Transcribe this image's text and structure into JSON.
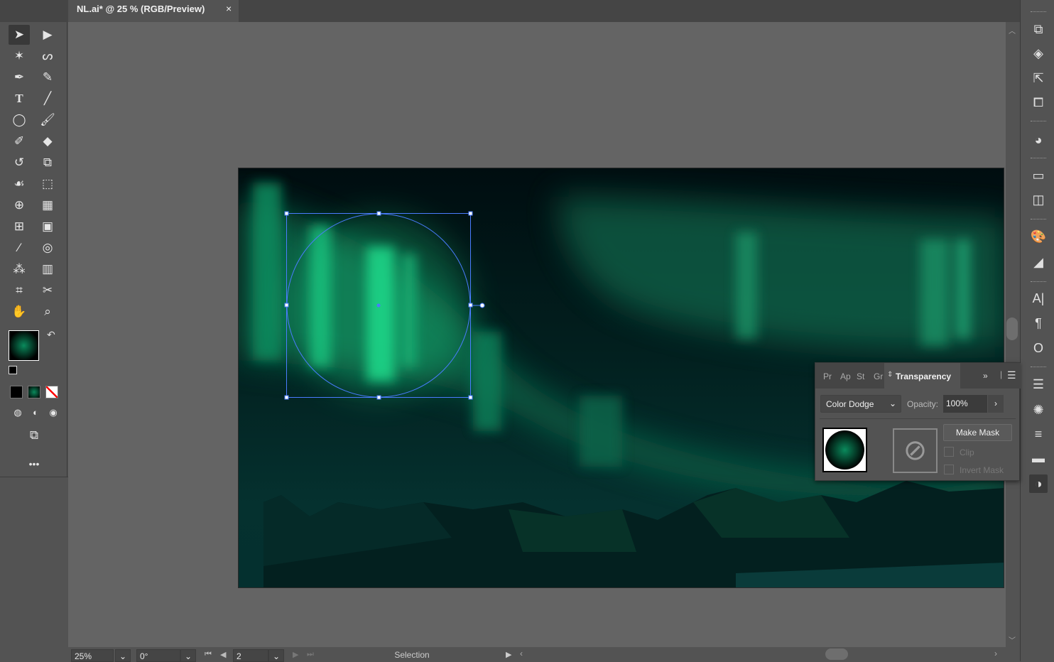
{
  "document": {
    "tab_title": "NL.ai* @ 25 % (RGB/Preview)",
    "close": "×"
  },
  "tools": [
    "selection",
    "direct-selection",
    "magic-wand",
    "lasso",
    "pen",
    "curvature",
    "type",
    "line-segment",
    "ellipse",
    "paintbrush",
    "shaper",
    "eraser",
    "rotate",
    "scale",
    "warp",
    "free-transform",
    "shape-builder",
    "perspective-grid",
    "mesh",
    "gradient",
    "eyedropper",
    "blend",
    "symbol-sprayer",
    "column-graph",
    "artboard",
    "slice",
    "hand",
    "zoom"
  ],
  "colors": {
    "fill": "#0a8a5c",
    "accent": "#4a7cff",
    "panel_bg": "#535353"
  },
  "panel": {
    "tabs": [
      "Pr",
      "Ap",
      "St",
      "Gr"
    ],
    "active_tab": "Transparency",
    "blend_mode": "Color Dodge",
    "opacity_label": "Opacity:",
    "opacity_value": "100%",
    "make_mask": "Make Mask",
    "clip": "Clip",
    "invert_mask": "Invert Mask",
    "clip_checked": false,
    "invert_checked": false
  },
  "status": {
    "zoom": "25%",
    "rotation": "0°",
    "artboard": "2",
    "tool": "Selection"
  }
}
